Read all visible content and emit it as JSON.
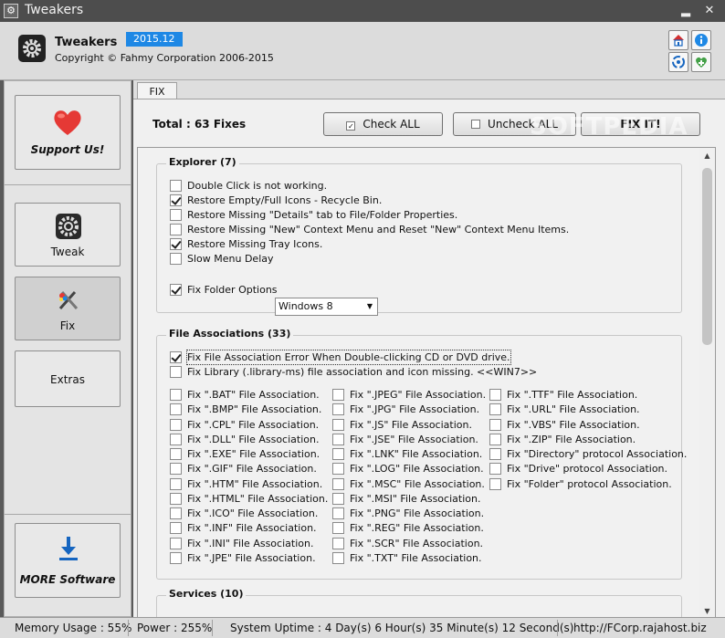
{
  "window": {
    "title": "Tweakers",
    "minimize": "▂",
    "close": "✕"
  },
  "header": {
    "app_name": "Tweakers",
    "version": "2015.12",
    "copyright": "Copyright © Fahmy Corporation 2006-2015"
  },
  "sidebar": {
    "support": "Support Us!",
    "tweak": "Tweak",
    "fix": "Fix",
    "extras": "Extras",
    "more": "MORE Software"
  },
  "tab": {
    "label": "FIX"
  },
  "toolbar": {
    "total": "Total : 63 Fixes",
    "check_all": "Check ALL",
    "uncheck_all": "Uncheck ALL",
    "fix_it": "FIX IT!"
  },
  "watermark": "SOFTPEDIA",
  "explorer": {
    "title": "Explorer (7)",
    "items": [
      {
        "label": "Double Click is not working.",
        "checked": false
      },
      {
        "label": "Restore Empty/Full Icons - Recycle Bin.",
        "checked": true
      },
      {
        "label": "Restore Missing \"Details\" tab to File/Folder Properties.",
        "checked": false
      },
      {
        "label": "Restore Missing \"New\" Context Menu and Reset \"New\" Context Menu Items.",
        "checked": false
      },
      {
        "label": "Restore Missing Tray Icons.",
        "checked": true
      },
      {
        "label": "Slow Menu Delay",
        "checked": false
      },
      {
        "label": "Fix Folder Options",
        "checked": true
      }
    ],
    "folder_options_value": "Windows 8"
  },
  "file_assoc": {
    "title": "File Associations (33)",
    "top_items": [
      {
        "label": "Fix File Association Error When Double-clicking CD or DVD drive.",
        "checked": true
      },
      {
        "label": "Fix Library (.library-ms) file association and icon missing. <<WIN7>>",
        "checked": false
      }
    ],
    "col1": [
      "Fix \".BAT\" File Association.",
      "Fix \".BMP\" File Association.",
      "Fix \".CPL\" File Association.",
      "Fix \".DLL\" File Association.",
      "Fix \".EXE\" File Association.",
      "Fix \".GIF\" File Association.",
      "Fix \".HTM\" File Association.",
      "Fix \".HTML\" File Association.",
      "Fix \".ICO\" File Association.",
      "Fix \".INF\" File Association.",
      "Fix \".INI\" File Association.",
      "Fix \".JPE\" File Association."
    ],
    "col2": [
      "Fix \".JPEG\" File Association.",
      "Fix \".JPG\" File Association.",
      "Fix \".JS\" File Association.",
      "Fix \".JSE\" File Association.",
      "Fix \".LNK\" File Association.",
      "Fix \".LOG\" File Association.",
      "Fix \".MSC\" File Association.",
      "Fix \".MSI\" File Association.",
      "Fix \".PNG\" File Association.",
      "Fix \".REG\" File Association.",
      "Fix \".SCR\" File Association.",
      "Fix \".TXT\" File Association."
    ],
    "col3": [
      "Fix \".TTF\" File Association.",
      "Fix \".URL\" File Association.",
      "Fix \".VBS\" File Association.",
      "Fix \".ZIP\" File Association.",
      "Fix \"Directory\" protocol Association.",
      "Fix \"Drive\" protocol Association.",
      "Fix \"Folder\" protocol Association."
    ]
  },
  "services": {
    "title": "Services (10)"
  },
  "status": {
    "memory": "Memory Usage : 55%",
    "power": "Power : 255%",
    "uptime": "System Uptime : 4 Day(s) 6 Hour(s) 35 Minute(s) 12 Second(s)",
    "url": "http://FCorp.rajahost.biz"
  },
  "colors": {
    "accent": "#1e88e5",
    "heart": "#e53935",
    "download": "#1565c0"
  }
}
